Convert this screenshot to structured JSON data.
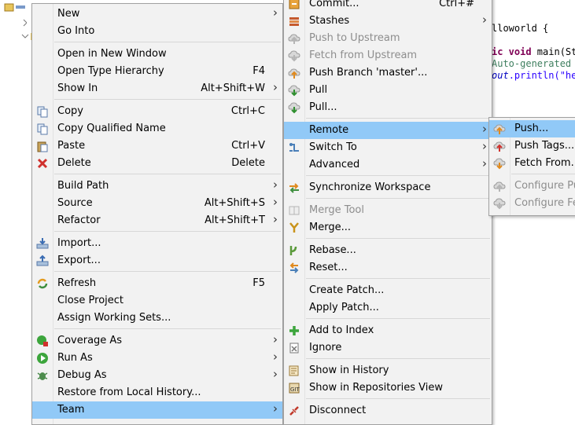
{
  "code": {
    "line1": "lloworld {",
    "line2_kw": "ic void",
    "line2_rest": " main(St",
    "line3": "Auto-generated",
    "line4_fld": "out",
    "line4_rest": ".println(\"he"
  },
  "main_menu": {
    "items": [
      {
        "label": "New",
        "submenu": true
      },
      {
        "label": "Go Into"
      },
      {
        "label": "Open in New Window"
      },
      {
        "label": "Open Type Hierarchy",
        "shortcut": "F4"
      },
      {
        "label": "Show In",
        "shortcut": "Alt+Shift+W",
        "submenu": true
      },
      {
        "label": "Copy",
        "shortcut": "Ctrl+C",
        "icon": "copy-icon"
      },
      {
        "label": "Copy Qualified Name",
        "icon": "copy-qualified-icon"
      },
      {
        "label": "Paste",
        "shortcut": "Ctrl+V",
        "icon": "paste-icon"
      },
      {
        "label": "Delete",
        "shortcut": "Delete",
        "icon": "delete-icon"
      },
      {
        "label": "Build Path",
        "submenu": true
      },
      {
        "label": "Source",
        "shortcut": "Alt+Shift+S",
        "submenu": true
      },
      {
        "label": "Refactor",
        "shortcut": "Alt+Shift+T",
        "submenu": true
      },
      {
        "label": "Import...",
        "icon": "import-icon"
      },
      {
        "label": "Export...",
        "icon": "export-icon"
      },
      {
        "label": "Refresh",
        "shortcut": "F5",
        "icon": "refresh-icon"
      },
      {
        "label": "Close Project"
      },
      {
        "label": "Assign Working Sets..."
      },
      {
        "label": "Coverage As",
        "submenu": true,
        "icon": "coverage-icon"
      },
      {
        "label": "Run As",
        "submenu": true,
        "icon": "run-icon"
      },
      {
        "label": "Debug As",
        "submenu": true,
        "icon": "debug-icon"
      },
      {
        "label": "Restore from Local History..."
      },
      {
        "label": "Team",
        "submenu": true,
        "highlighted": true
      }
    ]
  },
  "team_menu": {
    "items": [
      {
        "label": "Commit...",
        "shortcut": "Ctrl+#",
        "icon": "commit-icon"
      },
      {
        "label": "Stashes",
        "submenu": true,
        "icon": "stash-icon"
      },
      {
        "label": "Push to Upstream",
        "disabled": true,
        "icon": "push-upstream-icon"
      },
      {
        "label": "Fetch from Upstream",
        "disabled": true,
        "icon": "fetch-upstream-icon"
      },
      {
        "label": "Push Branch 'master'...",
        "icon": "push-branch-icon"
      },
      {
        "label": "Pull",
        "icon": "pull-icon"
      },
      {
        "label": "Pull...",
        "icon": "pull-dialog-icon"
      },
      {
        "label": "Remote",
        "submenu": true,
        "highlighted": true
      },
      {
        "label": "Switch To",
        "submenu": true,
        "icon": "switch-icon"
      },
      {
        "label": "Advanced",
        "submenu": true
      },
      {
        "label": "Synchronize Workspace",
        "icon": "synchronize-icon"
      },
      {
        "label": "Merge Tool",
        "disabled": true,
        "icon": "merge-tool-icon"
      },
      {
        "label": "Merge...",
        "icon": "merge-icon"
      },
      {
        "label": "Rebase...",
        "icon": "rebase-icon"
      },
      {
        "label": "Reset...",
        "icon": "reset-icon"
      },
      {
        "label": "Create Patch..."
      },
      {
        "label": "Apply Patch..."
      },
      {
        "label": "Add to Index",
        "icon": "add-index-icon"
      },
      {
        "label": "Ignore",
        "icon": "ignore-icon"
      },
      {
        "label": "Show in History",
        "icon": "history-icon"
      },
      {
        "label": "Show in Repositories View",
        "icon": "repositories-icon"
      },
      {
        "label": "Disconnect",
        "icon": "disconnect-icon"
      }
    ]
  },
  "remote_menu": {
    "items": [
      {
        "label": "Push...",
        "highlighted": true,
        "icon": "push-icon"
      },
      {
        "label": "Push Tags...",
        "icon": "push-tags-icon"
      },
      {
        "label": "Fetch From...",
        "icon": "fetch-icon"
      },
      {
        "label": "Configure Pus",
        "disabled": true,
        "icon": "configure-push-icon"
      },
      {
        "label": "Configure Fet",
        "disabled": true,
        "icon": "configure-fetch-icon"
      }
    ]
  },
  "colors": {
    "highlight": "#91c9f7",
    "menu_bg": "#f2f2f2",
    "disabled_text": "#8d8d8d"
  }
}
